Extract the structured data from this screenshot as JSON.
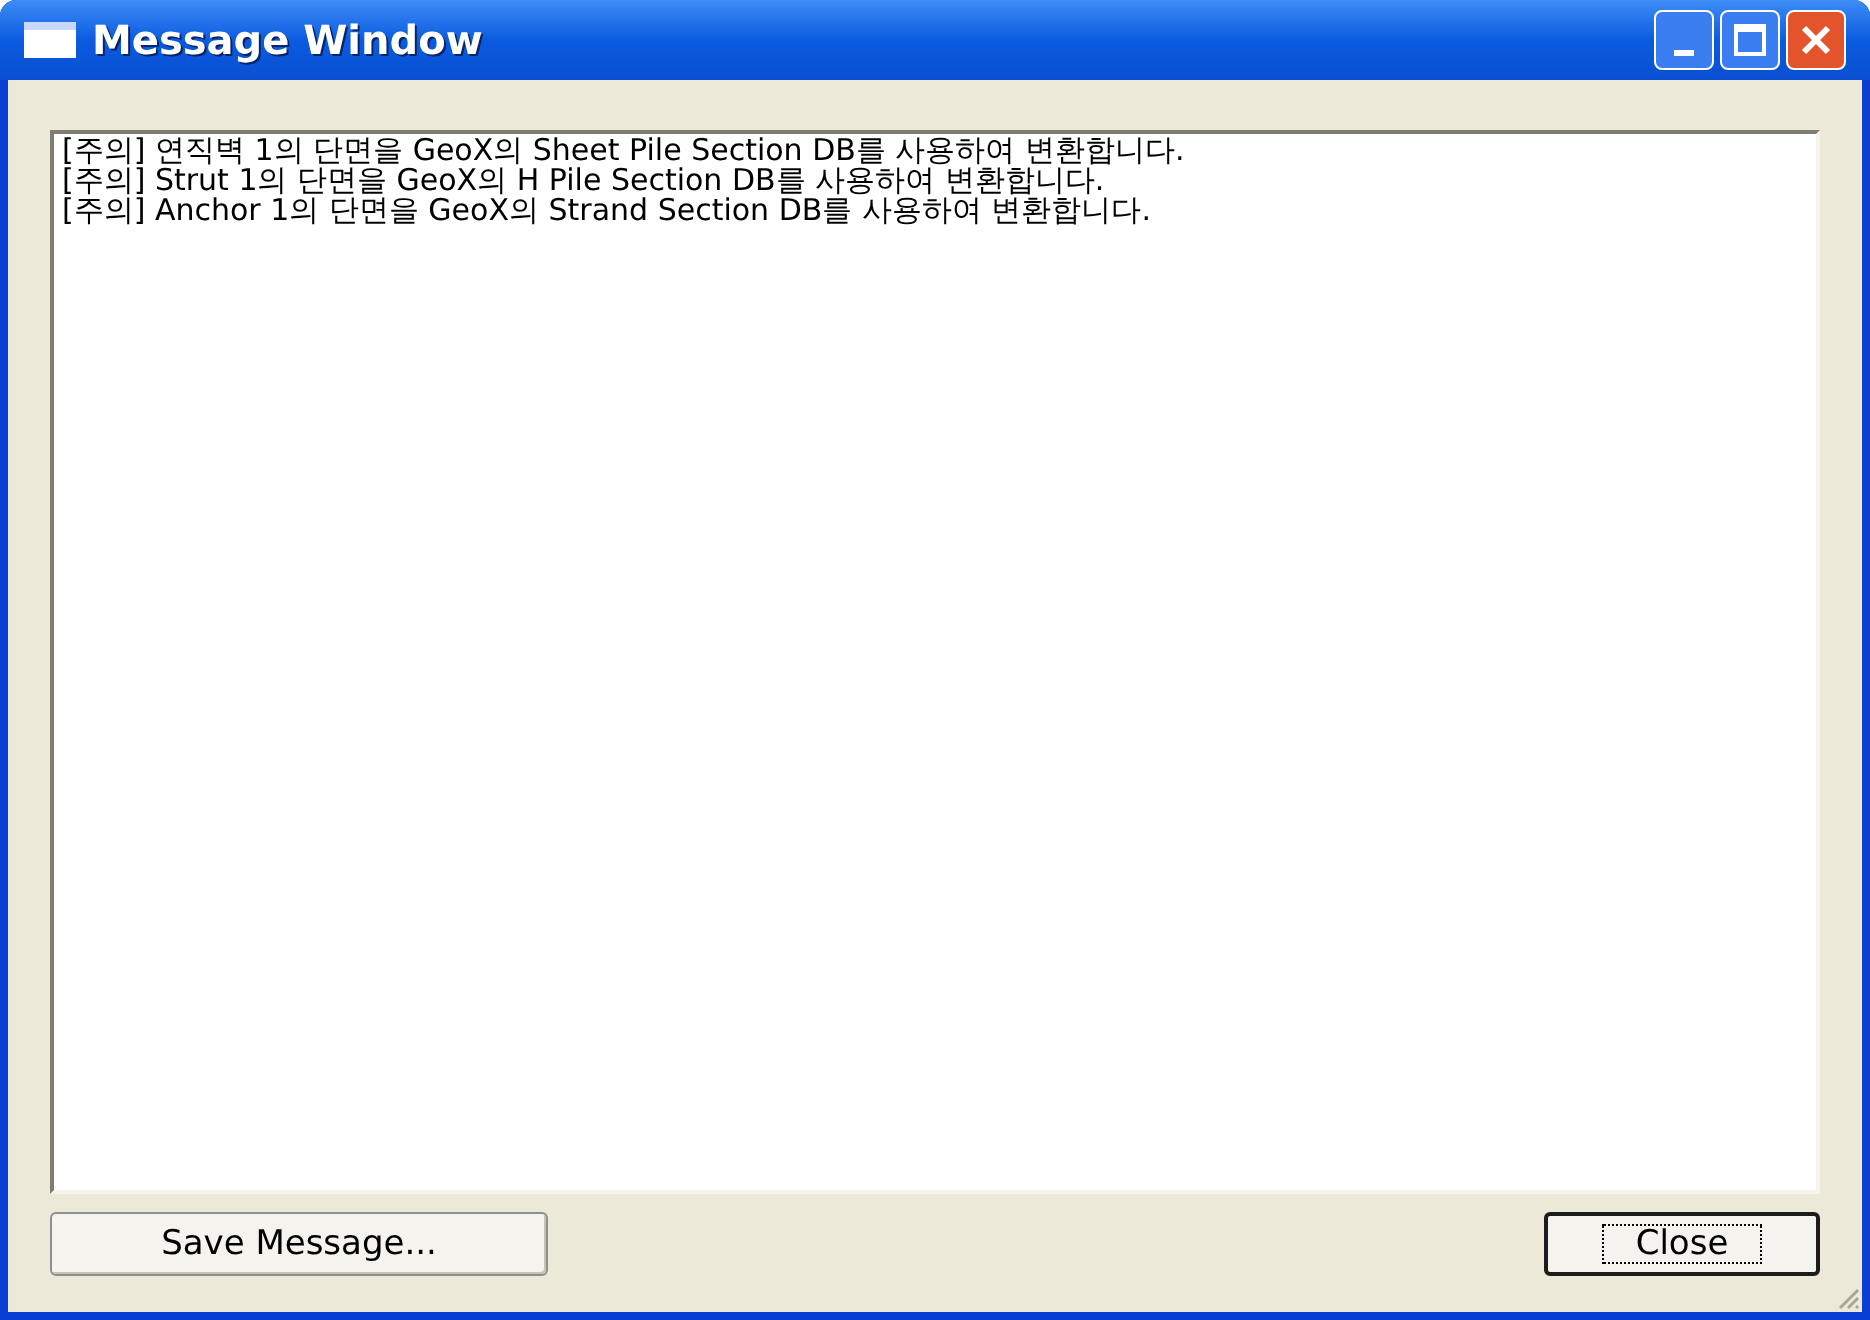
{
  "window": {
    "title": "Message Window"
  },
  "messages": [
    "[주의] 연직벽 1의 단면을 GeoX의 Sheet Pile Section DB를 사용하여 변환합니다.",
    "[주의] Strut 1의 단면을 GeoX의 H Pile Section DB를 사용하여 변환합니다.",
    "[주의] Anchor 1의 단면을 GeoX의 Strand Section DB를 사용하여 변환합니다."
  ],
  "buttons": [
    {
      "label": "Save Message...",
      "focused": false
    },
    {
      "label": "Close",
      "focused": true
    }
  ]
}
